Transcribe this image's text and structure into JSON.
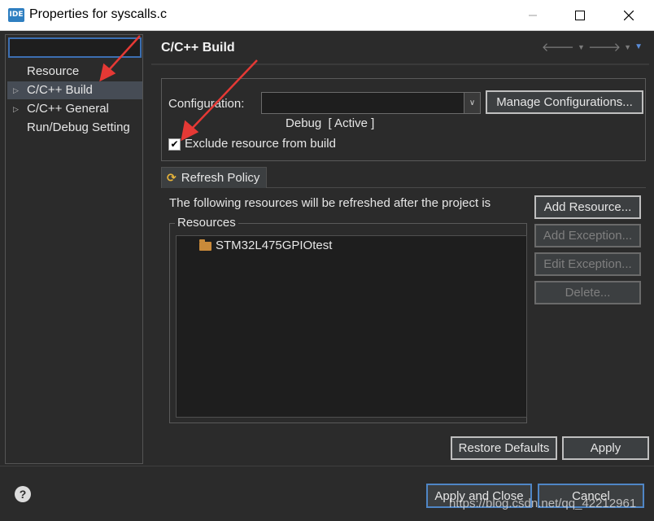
{
  "window": {
    "app_icon_text": "IDE",
    "title": "Properties for syscalls.c",
    "minimize_icon": "minimize-icon",
    "maximize_icon": "maximize-icon",
    "close_icon": "close-icon"
  },
  "sidebar": {
    "filter_value": "",
    "items": [
      {
        "label": "Resource",
        "expandable": false,
        "selected": false
      },
      {
        "label": "C/C++ Build",
        "expandable": true,
        "selected": true
      },
      {
        "label": "C/C++ General",
        "expandable": true,
        "selected": false
      },
      {
        "label": "Run/Debug Setting",
        "expandable": false,
        "selected": false
      }
    ]
  },
  "page": {
    "title": "C/C++ Build",
    "configuration_label": "Configuration:",
    "configuration_value": "Debug  [ Active ]",
    "manage_button": "Manage Configurations...",
    "exclude_label": "Exclude resource from build",
    "exclude_checked": true,
    "tab_label": "Refresh Policy",
    "description": "The following resources will be refreshed after the project is",
    "resources_legend": "Resources",
    "resources": [
      "STM32L475GPIOtest"
    ],
    "add_resource_button": "Add Resource...",
    "add_exception_button": "Add Exception...",
    "edit_exception_button": "Edit Exception...",
    "delete_button": "Delete...",
    "restore_defaults_button": "Restore Defaults",
    "apply_button": "Apply"
  },
  "footer": {
    "apply_close_button": "Apply and Close",
    "cancel_button": "Cancel",
    "watermark": "https://blog.csdn.net/qq_42212961"
  },
  "colors": {
    "background": "#2b2b2b",
    "accent": "#4f86c6",
    "annotation_arrow": "#e53935",
    "folder": "#c98a3a",
    "refresh_icon": "#e8b53a"
  }
}
